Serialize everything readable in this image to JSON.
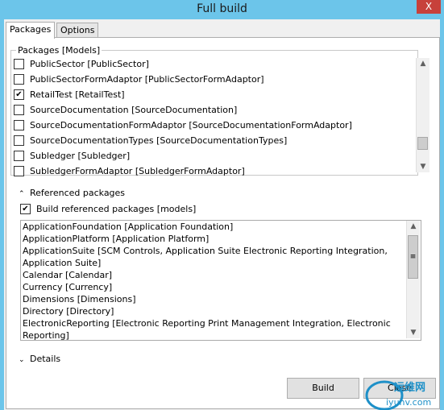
{
  "window": {
    "title": "Full build",
    "close_glyph": "X"
  },
  "tabs": [
    {
      "label": "Packages",
      "active": true
    },
    {
      "label": "Options",
      "active": false
    }
  ],
  "packages": {
    "legend": "Packages [Models]",
    "items": [
      {
        "label": "PublicSector [PublicSector]",
        "checked": false
      },
      {
        "label": "PublicSectorFormAdaptor [PublicSectorFormAdaptor]",
        "checked": false
      },
      {
        "label": "RetailTest [RetailTest]",
        "checked": true
      },
      {
        "label": "SourceDocumentation [SourceDocumentation]",
        "checked": false
      },
      {
        "label": "SourceDocumentationFormAdaptor [SourceDocumentationFormAdaptor]",
        "checked": false
      },
      {
        "label": "SourceDocumentationTypes [SourceDocumentationTypes]",
        "checked": false
      },
      {
        "label": "Subledger [Subledger]",
        "checked": false
      },
      {
        "label": "SubledgerFormAdaptor [SubledgerFormAdaptor]",
        "checked": false
      }
    ]
  },
  "referenced": {
    "header": "Referenced packages",
    "build_label": "Build referenced packages [models]",
    "build_checked": true,
    "items": [
      "ApplicationFoundation [Application Foundation]",
      "ApplicationPlatform [Application Platform]",
      "ApplicationSuite [SCM Controls, Application Suite Electronic Reporting Integration,",
      "Application Suite]",
      "Calendar [Calendar]",
      "Currency [Currency]",
      "Dimensions [Dimensions]",
      "Directory [Directory]",
      "ElectronicReporting [Electronic Reporting Print Management Integration, Electronic",
      "Reporting]"
    ]
  },
  "details": {
    "header": "Details"
  },
  "buttons": {
    "build": "Build",
    "close": "Close"
  },
  "watermark": {
    "line1": "运维网",
    "line2": "iyunv.com"
  },
  "colors": {
    "titlebar": "#6cc5ea",
    "close": "#c7413b",
    "accent": "#1e90c8"
  }
}
